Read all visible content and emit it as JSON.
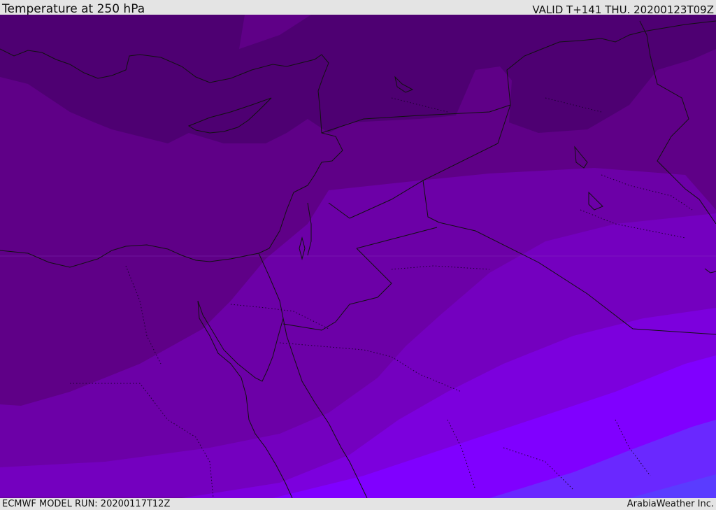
{
  "header": {
    "title": "Temperature at 250 hPa",
    "valid": "VALID T+141 THU. 20200123T09Z"
  },
  "footer": {
    "model_run": "ECMWF MODEL RUN: 20200117T12Z",
    "credit": "ArabiaWeather Inc."
  },
  "map": {
    "variable": "Temperature",
    "level": "250 hPa",
    "band_colors": [
      "#4e0072",
      "#5f0087",
      "#6c00a7",
      "#7400bf",
      "#7c00dd",
      "#8000ff",
      "#6a28ff",
      "#5a3cff"
    ],
    "outline_color": "#111111"
  }
}
